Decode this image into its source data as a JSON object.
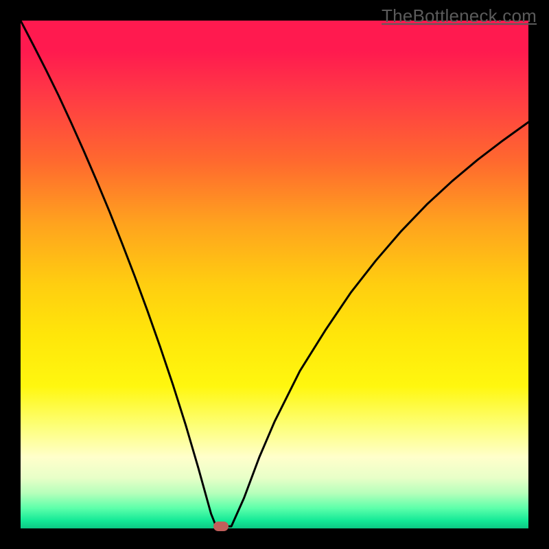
{
  "attribution": {
    "text": "TheBottleneck.com"
  },
  "colors": {
    "frame": "#000000",
    "curve_stroke": "#000000",
    "marker_fill": "#C15F5B",
    "attribution_text": "#5b5b5b"
  },
  "chart_data": {
    "type": "line",
    "title": "",
    "xlabel": "",
    "ylabel": "",
    "xlim": [
      0,
      100
    ],
    "ylim": [
      0,
      100
    ],
    "grid": false,
    "legend": false,
    "series": [
      {
        "name": "bottleneck-curve",
        "x": [
          0,
          2.5,
          5,
          7.5,
          10,
          12.5,
          15,
          17.5,
          20,
          22.5,
          25,
          27.5,
          30,
          32.5,
          35,
          36.5,
          37.5,
          38.5,
          39.3,
          41.5,
          44,
          47,
          50,
          55,
          60,
          65,
          70,
          75,
          80,
          85,
          90,
          95,
          100
        ],
        "y": [
          100,
          95.2,
          90.3,
          85.2,
          79.8,
          74.2,
          68.4,
          62.4,
          56.1,
          49.6,
          42.8,
          35.7,
          28.3,
          20.4,
          11.9,
          6.5,
          2.9,
          0.4,
          0.4,
          0.4,
          6,
          14,
          21,
          31,
          39,
          46.4,
          52.8,
          58.6,
          63.8,
          68.4,
          72.6,
          76.4,
          80
        ],
        "note": "Pixel-plot traces a V-shaped black curve with minimum around x≈38–41."
      }
    ],
    "annotations": {
      "min_marker": {
        "x": 39.5,
        "y": 0.4,
        "shape": "rounded-pill",
        "color": "#C15F5B"
      }
    }
  }
}
